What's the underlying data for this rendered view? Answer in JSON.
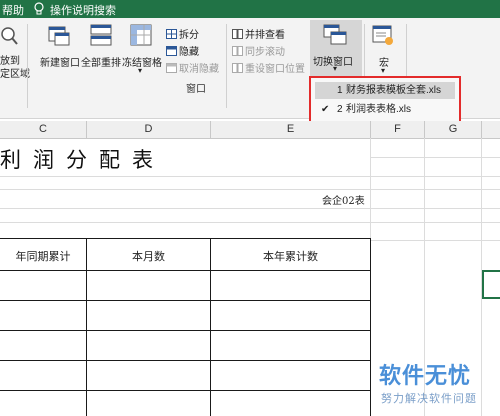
{
  "ribbon": {
    "top_tabs": {
      "help": "帮助",
      "tell_me": "操作说明搜索"
    },
    "zoom_to_selection": {
      "line1": "放到",
      "line2": "定区域"
    },
    "new_window": "新建窗口",
    "arrange_all": "全部重排",
    "freeze_panes": "冻结窗格",
    "split": "拆分",
    "hide": "隐藏",
    "unhide": "取消隐藏",
    "view_side_by_side": "并排查看",
    "sync_scroll": "同步滚动",
    "reset_position": "重设窗口位置",
    "switch_windows": "切换窗口",
    "macros": "宏",
    "group_window": "窗口"
  },
  "switch_menu": {
    "items": [
      {
        "num": "1",
        "label": "财务报表模板全套.xls",
        "checked": false
      },
      {
        "num": "2",
        "label": "利润表表格.xls",
        "checked": true
      }
    ]
  },
  "columns": [
    "C",
    "D",
    "E",
    "F",
    "G"
  ],
  "sheet": {
    "title": "利润分配表",
    "code": "会企02表",
    "headers": [
      "年同期累计",
      "本月数",
      "本年累计数"
    ]
  },
  "watermark": {
    "logo": "软件无忧",
    "sub": "努力解决软件问题"
  },
  "colors": {
    "ribbon_green": "#217346",
    "highlight_red": "#e32b2b",
    "watermark_blue": "#4a8fd8"
  }
}
